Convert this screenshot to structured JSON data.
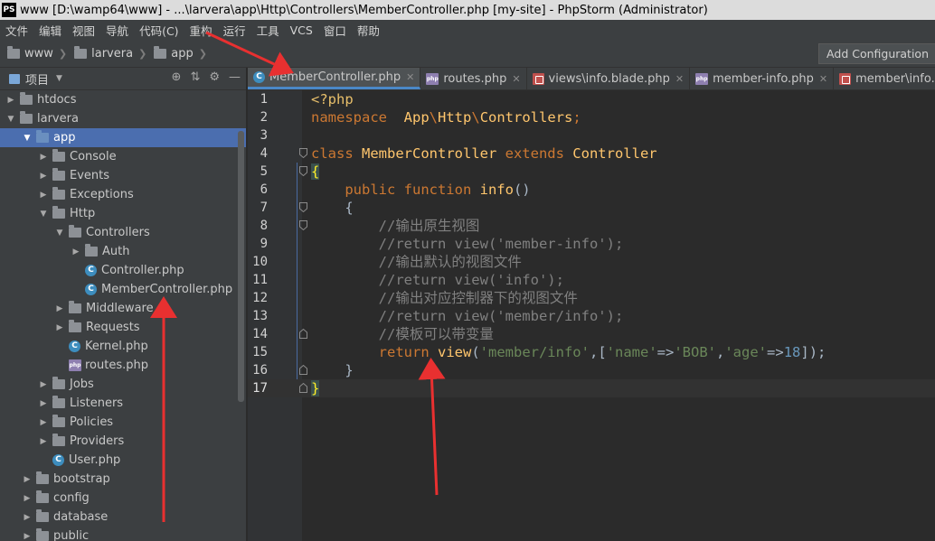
{
  "window": {
    "app_icon": "PS",
    "title": "www [D:\\wamp64\\www] - ...\\larvera\\app\\Http\\Controllers\\MemberController.php [my-site] - PhpStorm (Administrator)"
  },
  "menu": [
    "文件",
    "编辑",
    "视图",
    "导航",
    "代码(C)",
    "重构",
    "运行",
    "工具",
    "VCS",
    "窗口",
    "帮助"
  ],
  "breadcrumb": [
    "www",
    "larvera",
    "app"
  ],
  "toolbar": {
    "add_config": "Add Configuration"
  },
  "project_panel": {
    "label": "项目"
  },
  "tree": [
    {
      "label": "htdocs",
      "type": "folder",
      "depth": 1,
      "expanded": false
    },
    {
      "label": "larvera",
      "type": "folder",
      "depth": 1,
      "expanded": true
    },
    {
      "label": "app",
      "type": "folder",
      "depth": 2,
      "expanded": true,
      "selected": true
    },
    {
      "label": "Console",
      "type": "folder",
      "depth": 3,
      "expanded": false
    },
    {
      "label": "Events",
      "type": "folder",
      "depth": 3,
      "expanded": false
    },
    {
      "label": "Exceptions",
      "type": "folder",
      "depth": 3,
      "expanded": false
    },
    {
      "label": "Http",
      "type": "folder",
      "depth": 3,
      "expanded": true
    },
    {
      "label": "Controllers",
      "type": "folder",
      "depth": 4,
      "expanded": true
    },
    {
      "label": "Auth",
      "type": "folder",
      "depth": 5,
      "expanded": false
    },
    {
      "label": "Controller.php",
      "type": "class",
      "depth": 5
    },
    {
      "label": "MemberController.php",
      "type": "class",
      "depth": 5
    },
    {
      "label": "Middleware",
      "type": "folder",
      "depth": 4,
      "expanded": false
    },
    {
      "label": "Requests",
      "type": "folder",
      "depth": 4,
      "expanded": false
    },
    {
      "label": "Kernel.php",
      "type": "class",
      "depth": 4
    },
    {
      "label": "routes.php",
      "type": "php",
      "depth": 4
    },
    {
      "label": "Jobs",
      "type": "folder",
      "depth": 3,
      "expanded": false
    },
    {
      "label": "Listeners",
      "type": "folder",
      "depth": 3,
      "expanded": false
    },
    {
      "label": "Policies",
      "type": "folder",
      "depth": 3,
      "expanded": false
    },
    {
      "label": "Providers",
      "type": "folder",
      "depth": 3,
      "expanded": false
    },
    {
      "label": "User.php",
      "type": "class",
      "depth": 3
    },
    {
      "label": "bootstrap",
      "type": "folder",
      "depth": 2,
      "expanded": false
    },
    {
      "label": "config",
      "type": "folder",
      "depth": 2,
      "expanded": false
    },
    {
      "label": "database",
      "type": "folder",
      "depth": 2,
      "expanded": false
    },
    {
      "label": "public",
      "type": "folder",
      "depth": 2,
      "expanded": false
    }
  ],
  "tabs": [
    {
      "label": "MemberController.php",
      "icon": "class",
      "active": true
    },
    {
      "label": "routes.php",
      "icon": "php",
      "active": false
    },
    {
      "label": "views\\info.blade.php",
      "icon": "blade",
      "active": false
    },
    {
      "label": "member-info.php",
      "icon": "php",
      "active": false
    },
    {
      "label": "member\\info.blade.p",
      "icon": "blade",
      "active": false
    }
  ],
  "code_lines": [
    {
      "n": "1",
      "tokens": [
        [
          "ph",
          "<?php"
        ]
      ]
    },
    {
      "n": "2",
      "tokens": [
        [
          "kw",
          "namespace"
        ],
        [
          "ns",
          "  "
        ],
        [
          "cls",
          "App"
        ],
        [
          "kw",
          "\\"
        ],
        [
          "cls",
          "Http"
        ],
        [
          "kw",
          "\\"
        ],
        [
          "cls",
          "Controllers"
        ],
        [
          "kw",
          ";"
        ]
      ]
    },
    {
      "n": "3",
      "tokens": []
    },
    {
      "n": "4",
      "tokens": [
        [
          "kw",
          "class "
        ],
        [
          "cls",
          "MemberController "
        ],
        [
          "kw",
          "extends "
        ],
        [
          "cls",
          "Controller"
        ]
      ]
    },
    {
      "n": "5",
      "tokens": [
        [
          "hl",
          "{"
        ]
      ]
    },
    {
      "n": "6",
      "tokens": [
        [
          "ns",
          "    "
        ],
        [
          "kw",
          "public function "
        ],
        [
          "fn",
          "info"
        ],
        [
          "ns",
          "()"
        ]
      ]
    },
    {
      "n": "7",
      "tokens": [
        [
          "ns",
          "    {"
        ]
      ]
    },
    {
      "n": "8",
      "tokens": [
        [
          "cm",
          "        //输出原生视图"
        ]
      ]
    },
    {
      "n": "9",
      "tokens": [
        [
          "cm",
          "        //return view('member-info');"
        ]
      ]
    },
    {
      "n": "10",
      "tokens": [
        [
          "cm",
          "        //输出默认的视图文件"
        ]
      ]
    },
    {
      "n": "11",
      "tokens": [
        [
          "cm",
          "        //return view('info');"
        ]
      ]
    },
    {
      "n": "12",
      "tokens": [
        [
          "cm",
          "        //输出对应控制器下的视图文件"
        ]
      ]
    },
    {
      "n": "13",
      "tokens": [
        [
          "cm",
          "        //return view('member/info');"
        ]
      ]
    },
    {
      "n": "14",
      "tokens": [
        [
          "cm",
          "        //模板可以带变量"
        ]
      ]
    },
    {
      "n": "15",
      "tokens": [
        [
          "ns",
          "        "
        ],
        [
          "kw",
          "return "
        ],
        [
          "fn",
          "view"
        ],
        [
          "ns",
          "("
        ],
        [
          "str",
          "'member/info'"
        ],
        [
          "ns",
          ",["
        ],
        [
          "str",
          "'name'"
        ],
        [
          "ns",
          "=>"
        ],
        [
          "str",
          "'BOB'"
        ],
        [
          "ns",
          ","
        ],
        [
          "str",
          "'age'"
        ],
        [
          "ns",
          "=>"
        ],
        [
          "num",
          "18"
        ],
        [
          "ns",
          "]);"
        ]
      ]
    },
    {
      "n": "16",
      "tokens": [
        [
          "ns",
          "    }"
        ]
      ]
    },
    {
      "n": "17",
      "tokens": [
        [
          "hl",
          "}"
        ]
      ]
    }
  ],
  "annotation_color": "#e83030"
}
